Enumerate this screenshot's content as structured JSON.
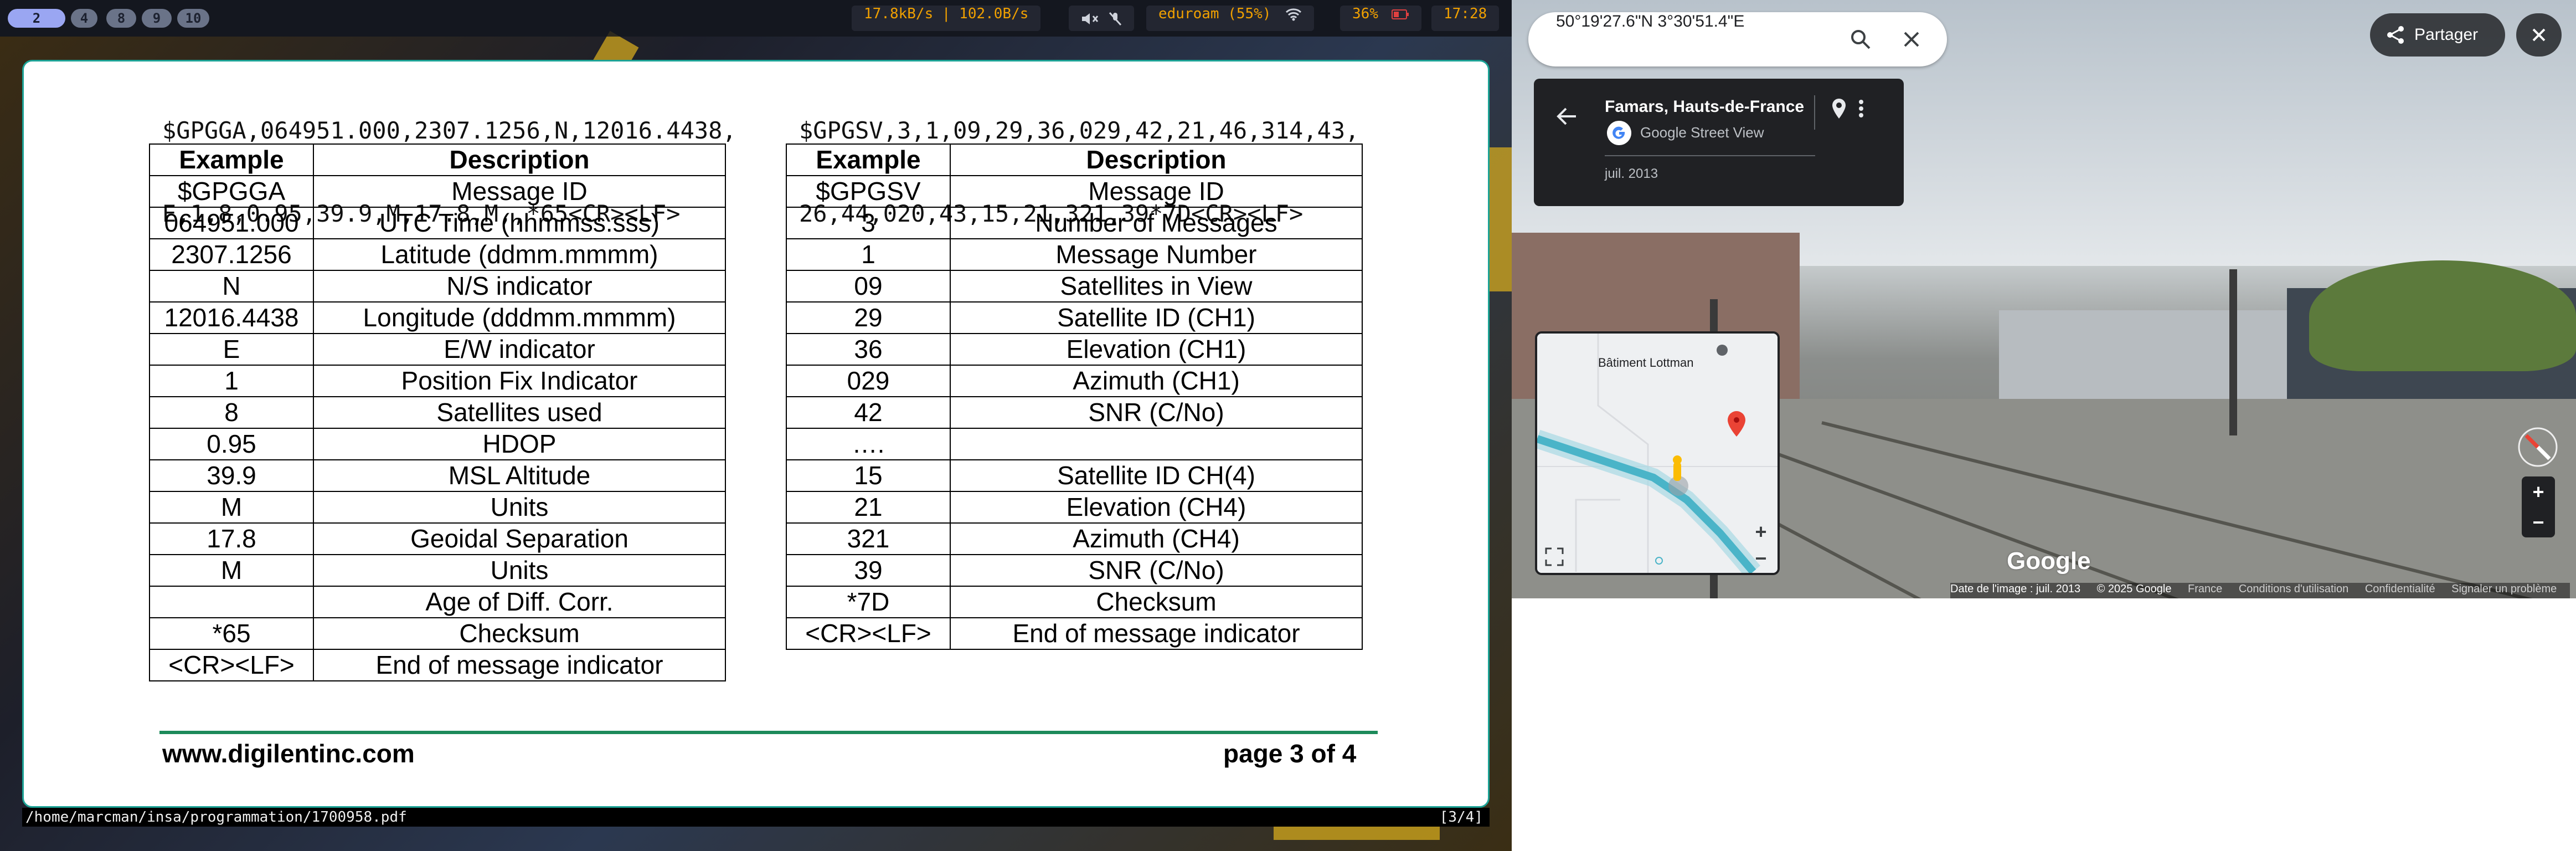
{
  "statusbar": {
    "workspaces": [
      {
        "label": "2",
        "active": true
      },
      {
        "label": "4",
        "active": false
      },
      {
        "label": "8",
        "active": false
      },
      {
        "label": "9",
        "active": false
      },
      {
        "label": "10",
        "active": false
      }
    ],
    "network_speed": "17.8kB/s | 102.0B/s",
    "wifi": "eduroam (55%)",
    "battery": "36%",
    "clock": "17:28"
  },
  "pdf": {
    "gpgga_sentence": [
      "$GPGGA,064951.000,2307.1256,N,12016.4438,",
      "E,1,8,0.95,39.9,M,17.8,M,,*65<CR><LF>"
    ],
    "gpgsv_sentence": [
      "$GPGSV,3,1,09,29,36,029,42,21,46,314,43,",
      "26,44,020,43,15,21,321,39*7D<CR><LF>"
    ],
    "table_headers": [
      "Example",
      "Description"
    ],
    "gga_rows": [
      [
        "$GPGGA",
        "Message ID"
      ],
      [
        "064951.000",
        "UTC Time (hhmmss.sss)"
      ],
      [
        "2307.1256",
        "Latitude (ddmm.mmmm)"
      ],
      [
        "N",
        "N/S indicator"
      ],
      [
        "12016.4438",
        "Longitude (dddmm.mmmm)"
      ],
      [
        "E",
        "E/W indicator"
      ],
      [
        "1",
        "Position Fix Indicator"
      ],
      [
        "8",
        "Satellites used"
      ],
      [
        "0.95",
        "HDOP"
      ],
      [
        "39.9",
        "MSL Altitude"
      ],
      [
        "M",
        "Units"
      ],
      [
        "17.8",
        "Geoidal Separation"
      ],
      [
        "M",
        "Units"
      ],
      [
        "",
        "Age of Diff. Corr."
      ],
      [
        "*65",
        "Checksum"
      ],
      [
        "<CR><LF>",
        "End of message indicator"
      ]
    ],
    "gsv_rows": [
      [
        "$GPGSV",
        "Message ID"
      ],
      [
        "3",
        "Number of Messages"
      ],
      [
        "1",
        "Message Number"
      ],
      [
        "09",
        "Satellites in View"
      ],
      [
        "29",
        "Satellite ID (CH1)"
      ],
      [
        "36",
        "Elevation (CH1)"
      ],
      [
        "029",
        "Azimuth (CH1)"
      ],
      [
        "42",
        "SNR (C/No)"
      ],
      [
        "….",
        ""
      ],
      [
        "15",
        "Satellite ID CH(4)"
      ],
      [
        "21",
        "Elevation (CH4)"
      ],
      [
        "321",
        "Azimuth (CH4)"
      ],
      [
        "39",
        "SNR (C/No)"
      ],
      [
        "*7D",
        "Checksum"
      ],
      [
        "<CR><LF>",
        "End of message indicator"
      ]
    ],
    "footer_url": "www.digilentinc.com",
    "footer_page": "page 3 of 4",
    "file_path": "/home/marcman/insa/programmation/1700958.pdf",
    "page_indicator": "[3/4]"
  },
  "maps": {
    "search_value": "50°19'27.6\"N 3°30'51.4\"E",
    "share_label": "Partager",
    "place_name": "Famars, Hauts-de-France",
    "source_label": "Google Street View",
    "date_label": "juil. 2013",
    "minimap_label": "Bâtiment Lottman",
    "zoom_in": "+",
    "zoom_out": "−",
    "watermark": "Google",
    "attribution": [
      "Date de l'image : juil. 2013",
      "© 2025 Google",
      "France",
      "Conditions d'utilisation",
      "Confidentialité",
      "Signaler un problème"
    ]
  },
  "colors": {
    "pdf_border": "#1ca396",
    "status_text": "#f0a000",
    "pin_red": "#ea4335",
    "route_blue": "#4ab4c8"
  }
}
